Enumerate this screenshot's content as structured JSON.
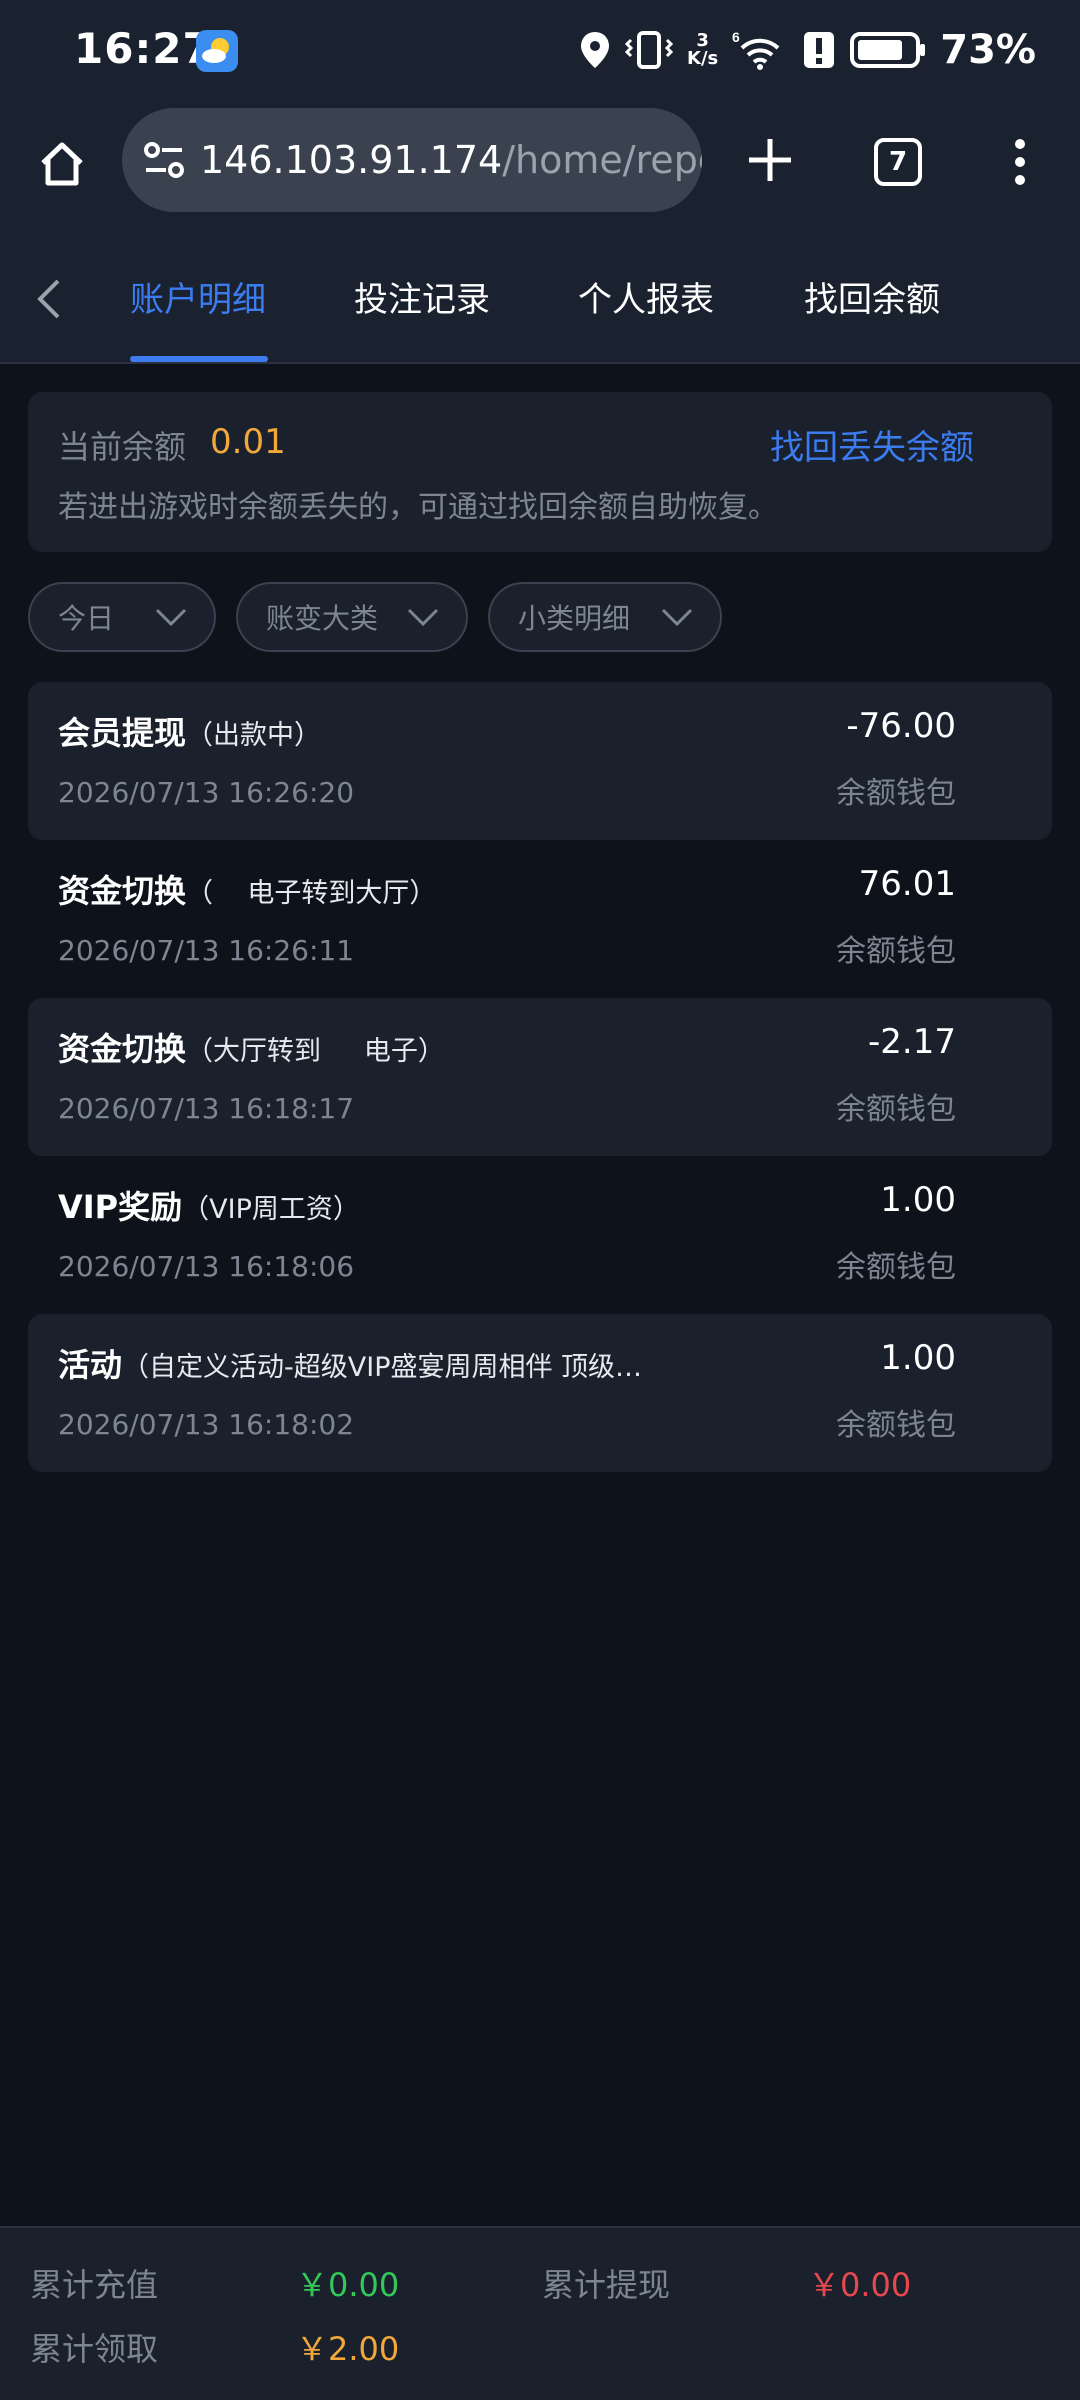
{
  "status_bar": {
    "time": "16:27",
    "net_speed_top": "3",
    "net_speed_bottom": "K/s",
    "signal_label": "6",
    "battery_percent": "73%"
  },
  "browser": {
    "url_host": "146.103.91.174",
    "url_path": "/home/repor",
    "tab_count": "7"
  },
  "tabs": [
    {
      "label": "账户明细",
      "active": true
    },
    {
      "label": "投注记录",
      "active": false
    },
    {
      "label": "个人报表",
      "active": false
    },
    {
      "label": "找回余额",
      "active": false
    }
  ],
  "balance": {
    "label": "当前余额",
    "value": "0.01",
    "recover_link": "找回丢失余额",
    "hint": "若进出游戏时余额丢失的，可通过找回余额自助恢复。"
  },
  "filters": [
    {
      "label": "今日"
    },
    {
      "label": "账变大类"
    },
    {
      "label": "小类明细"
    }
  ],
  "transactions": [
    {
      "title": "会员提现",
      "subtitle": "（出款中）",
      "time": "2026/07/13 16:26:20",
      "amount": "-76.00",
      "wallet": "余额钱包"
    },
    {
      "title": "资金切换",
      "subtitle": "（    电子转到大厅）",
      "time": "2026/07/13 16:26:11",
      "amount": "76.01",
      "wallet": "余额钱包"
    },
    {
      "title": "资金切换",
      "subtitle": "（大厅转到     电子）",
      "time": "2026/07/13 16:18:17",
      "amount": "-2.17",
      "wallet": "余额钱包"
    },
    {
      "title": "VIP奖励",
      "subtitle": "（VIP周工资）",
      "time": "2026/07/13 16:18:06",
      "amount": "1.00",
      "wallet": "余额钱包"
    },
    {
      "title": "活动",
      "subtitle": "（自定义活动-超级VIP盛宴周周相伴 顶级…",
      "time": "2026/07/13 16:18:02",
      "amount": "1.00",
      "wallet": "余额钱包"
    }
  ],
  "footer": {
    "total_deposit_label": "累计充值",
    "total_deposit_value": "￥0.00",
    "total_withdraw_label": "累计提现",
    "total_withdraw_value": "￥0.00",
    "total_claimed_label": "累计领取",
    "total_claimed_value": "￥2.00"
  },
  "colors": {
    "accent": "#3d7bf0",
    "balance": "#f2a73b",
    "deposit": "#34c759",
    "withdraw": "#e5484d",
    "claimed": "#f2a73b"
  }
}
